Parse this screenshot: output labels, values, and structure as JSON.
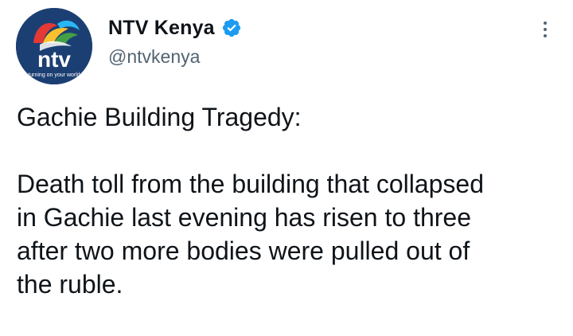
{
  "account": {
    "display_name": "NTV Kenya",
    "handle": "@ntvkenya",
    "verified": true,
    "avatar": {
      "logo_text": "ntv",
      "tagline": "turning on your world"
    }
  },
  "menu": {
    "icon": "more-dots-icon"
  },
  "tweet": {
    "heading": "Gachie Building Tragedy:",
    "body_lines": [
      "Death toll from the building that collapsed",
      "in Gachie last evening has risen to three",
      "after two more bodies were pulled out of",
      "the ruble."
    ]
  },
  "colors": {
    "text": "#0f1419",
    "secondary": "#536471",
    "verified_blue": "#1d9bf0",
    "avatar_bg": "#1c3f73"
  }
}
